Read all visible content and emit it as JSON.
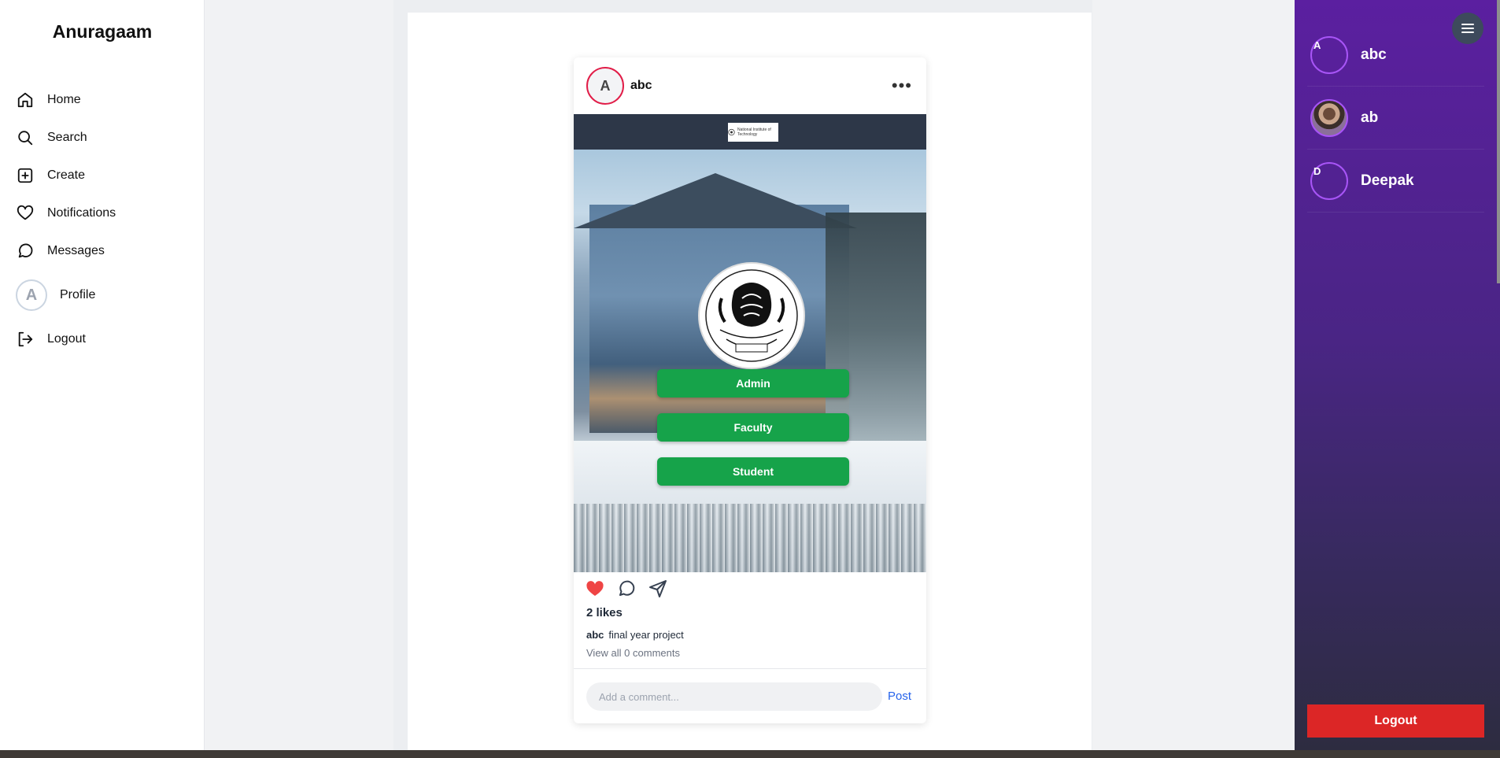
{
  "app": {
    "title": "Anuragaam"
  },
  "sidebar": {
    "items": [
      {
        "label": "Home",
        "icon": "home-icon"
      },
      {
        "label": "Search",
        "icon": "search-icon"
      },
      {
        "label": "Create",
        "icon": "plus-square-icon"
      },
      {
        "label": "Notifications",
        "icon": "heart-icon"
      },
      {
        "label": "Messages",
        "icon": "message-circle-icon"
      },
      {
        "label": "Profile",
        "icon": "avatar",
        "avatar_letter": "A"
      },
      {
        "label": "Logout",
        "icon": "logout-icon"
      }
    ]
  },
  "post": {
    "avatar_letter": "A",
    "username": "abc",
    "menu_glyph": "•••",
    "media": {
      "logo_text": "National Institute of Technology",
      "roles": [
        "Admin",
        "Faculty",
        "Student"
      ]
    },
    "liked": true,
    "likes_text": "2 likes",
    "caption_user": "abc",
    "caption_text": "final year project",
    "view_comments": "View all 0 comments",
    "comment_placeholder": "Add a comment...",
    "post_label": "Post"
  },
  "right_panel": {
    "users": [
      {
        "name": "abc",
        "letter": "A",
        "has_photo": false
      },
      {
        "name": "ab",
        "letter": "",
        "has_photo": true
      },
      {
        "name": "Deepak",
        "letter": "D",
        "has_photo": false
      }
    ],
    "logout_label": "Logout"
  },
  "colors": {
    "accent_green": "#16a34a",
    "like_red": "#ef4444",
    "panel_purple": "#5b1fa0",
    "logout_red": "#dc2626",
    "link_blue": "#2563eb"
  }
}
